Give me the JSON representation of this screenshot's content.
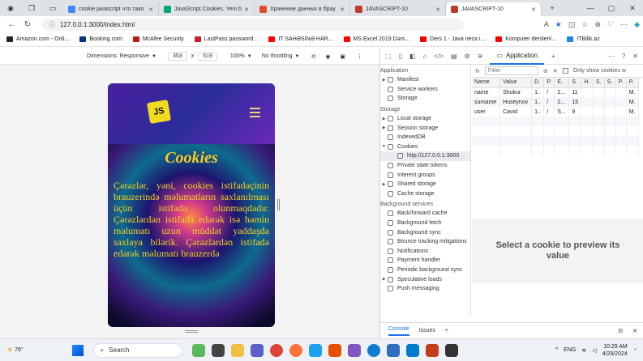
{
  "tabs": [
    {
      "title": "cookie javascript что тако",
      "color": "#4285f4",
      "active": false
    },
    {
      "title": "JavaScript Cookies. Yeni b",
      "color": "#04aa6d",
      "active": false
    },
    {
      "title": "Хранение данных в брау",
      "color": "#e34c26",
      "active": false
    },
    {
      "title": "JAVASCRIPT-10",
      "color": "#c0392b",
      "active": false
    },
    {
      "title": "JAVASCRIPT-10",
      "color": "#c0392b",
      "active": true
    }
  ],
  "url": "127.0.0.1:3000/index.html",
  "bookmarks": [
    {
      "label": "Amazon.com - Onli...",
      "color": "#222"
    },
    {
      "label": "Booking.com",
      "color": "#003580"
    },
    {
      "label": "McAfee Security",
      "color": "#c01818"
    },
    {
      "label": "LastPass password...",
      "color": "#cc2029"
    },
    {
      "label": "IT SAHƏSİNƏ HAR...",
      "color": "#ff0000"
    },
    {
      "label": "MS Excel 2019 Dərs...",
      "color": "#ff0000"
    },
    {
      "label": "Ders 1 - Java neca i...",
      "color": "#ff0000"
    },
    {
      "label": "Komputer dersleri/...",
      "color": "#ff0000"
    },
    {
      "label": "ITBilik.az",
      "color": "#1e88e5"
    }
  ],
  "device": {
    "dimensions": "Dimensions: Responsive",
    "width": "353",
    "x": "x",
    "height": "519",
    "zoom": "100%",
    "throttle": "No throttling"
  },
  "page": {
    "logo": "JS",
    "title": "Cookies",
    "text": "Çərəzlər, yəni, cookies istifadəçinin brauzerində məlumatların saxlanılması üçün istifadə olunmaqdadır. Çərəzlərdən istifadə edərək isə həmin məlumatı uzun müddət yaddaşda saxlaya bilərik. Çərəzlərdən istifadə edərək məlumatı brauzerdə"
  },
  "devtools": {
    "active_tab": "Application",
    "filter_placeholder": "Filter",
    "only_show": "Only show cookies w",
    "preview_text": "Select a cookie to preview its value",
    "drawer_console": "Console",
    "drawer_issues": "Issues",
    "sections": [
      {
        "title": "Application",
        "items": [
          {
            "label": "Manifest",
            "arrow": "▶"
          },
          {
            "label": "Service workers",
            "arrow": ""
          },
          {
            "label": "Storage",
            "arrow": ""
          }
        ]
      },
      {
        "title": "Storage",
        "items": [
          {
            "label": "Local storage",
            "arrow": "▶"
          },
          {
            "label": "Session storage",
            "arrow": "▶"
          },
          {
            "label": "IndexedDB",
            "arrow": ""
          },
          {
            "label": "Cookies",
            "arrow": "▼"
          },
          {
            "label": "http://127.0.0.1:3000",
            "arrow": "",
            "sub": true
          },
          {
            "label": "Private state tokens",
            "arrow": ""
          },
          {
            "label": "Interest groups",
            "arrow": ""
          },
          {
            "label": "Shared storage",
            "arrow": "▶"
          },
          {
            "label": "Cache storage",
            "arrow": ""
          }
        ]
      },
      {
        "title": "Background services",
        "items": [
          {
            "label": "Back/forward cache",
            "arrow": ""
          },
          {
            "label": "Background fetch",
            "arrow": ""
          },
          {
            "label": "Background sync",
            "arrow": ""
          },
          {
            "label": "Bounce tracking mitigations",
            "arrow": ""
          },
          {
            "label": "Notifications",
            "arrow": ""
          },
          {
            "label": "Payment handler",
            "arrow": ""
          },
          {
            "label": "Periodic background sync",
            "arrow": ""
          },
          {
            "label": "Speculative loads",
            "arrow": "▶"
          },
          {
            "label": "Push messaging",
            "arrow": ""
          }
        ]
      }
    ],
    "columns": [
      "Name",
      "Value",
      "D.",
      "P.",
      "E.",
      "S.",
      "H.",
      "S.",
      "S.",
      "P.",
      "P."
    ],
    "rows": [
      [
        "name",
        "Shukur",
        "1..",
        "/",
        "2...",
        "11",
        "",
        "",
        "",
        "",
        "M."
      ],
      [
        "surname",
        "Huseynov",
        "1..",
        "/",
        "2...",
        "15",
        "",
        "",
        "",
        "",
        "M."
      ],
      [
        "user",
        "Cavid",
        "1..",
        "/",
        "S...",
        "9",
        "",
        "",
        "",
        "",
        "M."
      ]
    ]
  },
  "taskbar": {
    "weather": "76°",
    "search": "Search",
    "lang": "ENG",
    "time": "10:29 AM",
    "date": "4/29/2024"
  }
}
